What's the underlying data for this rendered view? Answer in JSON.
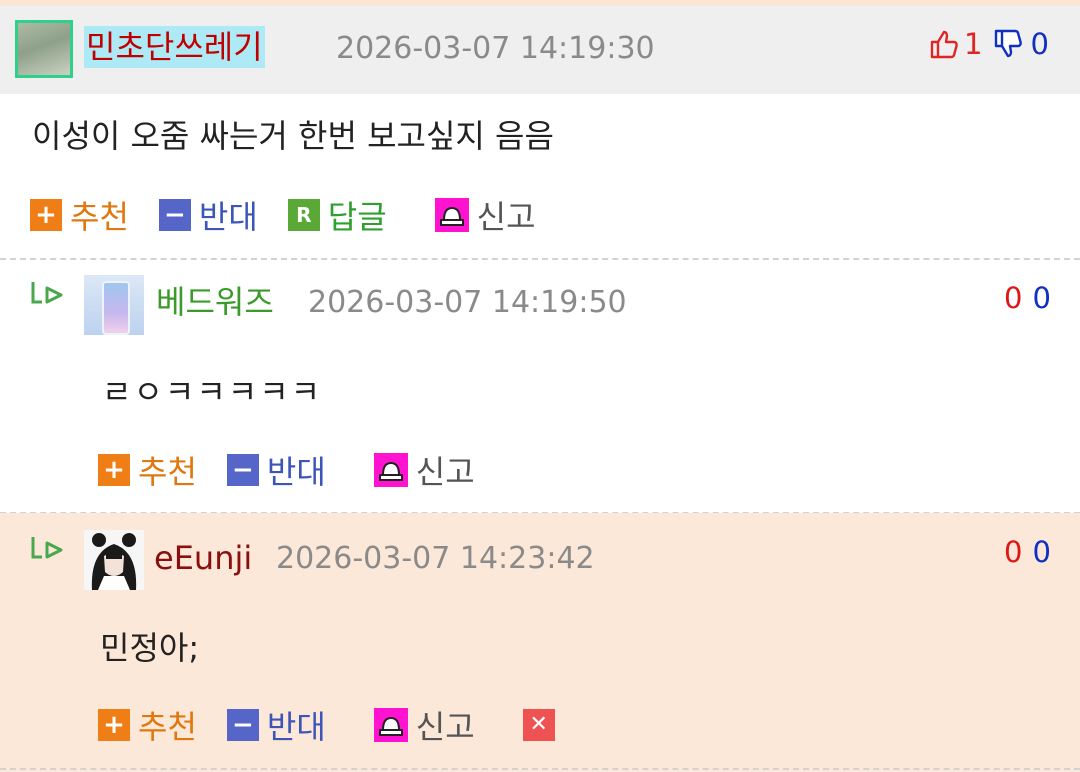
{
  "comments": [
    {
      "nickname": "민초단쓰레기",
      "timestamp": "2026-03-07 14:19:30",
      "upvotes": "1",
      "downvotes": "0",
      "text": "이성이 오줌 싸는거 한번 보고싶지 음음",
      "actions": {
        "recommend": "추천",
        "oppose": "반대",
        "reply": "답글",
        "report": "신고"
      }
    },
    {
      "nickname": "베드워즈",
      "timestamp": "2026-03-07 14:19:50",
      "upvotes": "0",
      "downvotes": "0",
      "text": "ㄹㅇㅋㅋㅋㅋㅋ",
      "actions": {
        "recommend": "추천",
        "oppose": "반대",
        "report": "신고"
      }
    },
    {
      "nickname": "eEunji",
      "timestamp": "2026-03-07 14:23:42",
      "upvotes": "0",
      "downvotes": "0",
      "text": "민정아;",
      "actions": {
        "recommend": "추천",
        "oppose": "반대",
        "report": "신고"
      }
    }
  ],
  "icons": {
    "thumbs_up": "thumbs-up-icon",
    "thumbs_down": "thumbs-down-icon",
    "reply_arrow": "reply-arrow-icon",
    "recommend": "plus-icon",
    "oppose": "minus-icon",
    "reply": "r-reply-icon",
    "report": "siren-icon",
    "delete": "close-icon"
  },
  "colors": {
    "header_bg": "#efefef",
    "highlight_bg": "#fce8d8",
    "recommend": "#ef7e17",
    "oppose": "#5566c8",
    "reply": "#5aa835",
    "report": "#ff12d0",
    "delete": "#ee5252",
    "upvote": "#e01515",
    "downvote": "#1030c0"
  }
}
